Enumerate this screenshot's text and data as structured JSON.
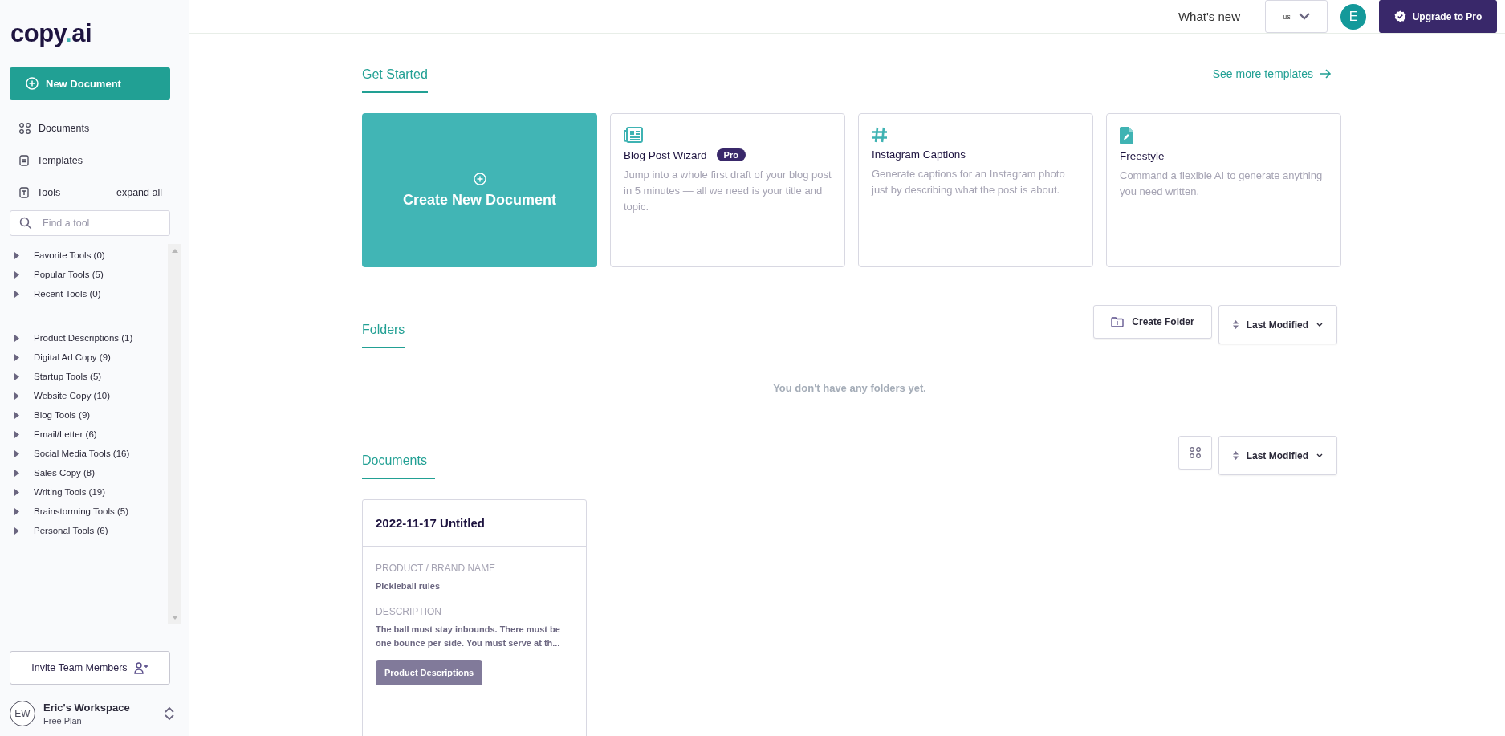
{
  "sidebar": {
    "logo": {
      "before": "copy",
      "dot": ".",
      "after": "ai"
    },
    "new_document": "New Document",
    "nav": [
      {
        "label": "Documents"
      },
      {
        "label": "Templates"
      },
      {
        "label": "Tools"
      }
    ],
    "expand_all": "expand all",
    "search": {
      "placeholder": "Find a tool"
    },
    "tool_groups": [
      [
        {
          "label": "Favorite Tools (0)",
          "expanded": false
        },
        {
          "label": "Popular Tools (5)",
          "expanded": false
        },
        {
          "label": "Recent Tools (0)",
          "expanded": false
        }
      ],
      [
        {
          "label": "Product Descriptions (1)",
          "expanded": false
        },
        {
          "label": "Digital Ad Copy (9)",
          "expanded": false
        },
        {
          "label": "Startup Tools (5)",
          "expanded": false
        },
        {
          "label": "Website Copy (10)",
          "expanded": false
        },
        {
          "label": "Blog Tools (9)",
          "expanded": false
        },
        {
          "label": "Email/Letter (6)",
          "expanded": false
        },
        {
          "label": "Social Media Tools (16)",
          "expanded": false
        },
        {
          "label": "Sales Copy (8)",
          "expanded": false
        },
        {
          "label": "Writing Tools (19)",
          "expanded": false
        },
        {
          "label": "Brainstorming Tools (5)",
          "expanded": false
        },
        {
          "label": "Personal Tools (6)",
          "expanded": false
        }
      ]
    ],
    "invite": "Invite Team Members",
    "workspace": {
      "initials": "EW",
      "name": "Eric's Workspace",
      "plan": "Free Plan"
    }
  },
  "header": {
    "whats_new": "What's new",
    "locale": "us",
    "avatar": "E",
    "upgrade": "Upgrade to Pro"
  },
  "get_started": {
    "title": "Get Started",
    "see_more": "See more templates",
    "cards": [
      {
        "kind": "create",
        "title": "Create New Document"
      },
      {
        "kind": "template",
        "title": "Blog Post Wizard",
        "badge": "Pro",
        "description": "Jump into a whole first draft of your blog post in 5 minutes — all we need is your title and topic."
      },
      {
        "kind": "template",
        "title": "Instagram Captions",
        "description": "Generate captions for an Instagram photo just by describing what the post is about."
      },
      {
        "kind": "template",
        "title": "Freestyle",
        "description": "Command a flexible AI to generate anything you need written."
      }
    ]
  },
  "folders": {
    "title": "Folders",
    "create": "Create Folder",
    "sort": "Last Modified",
    "empty": "You don't have any folders yet."
  },
  "documents": {
    "title": "Documents",
    "sort": "Last Modified",
    "items": [
      {
        "title": "2022-11-17 Untitled",
        "fields": [
          {
            "label": "PRODUCT / BRAND NAME",
            "value": "Pickleball rules"
          },
          {
            "label": "DESCRIPTION",
            "value": "The ball must stay inbounds. There must be one bounce per side. You must serve at th..."
          }
        ],
        "tag": "Product Descriptions"
      }
    ]
  }
}
